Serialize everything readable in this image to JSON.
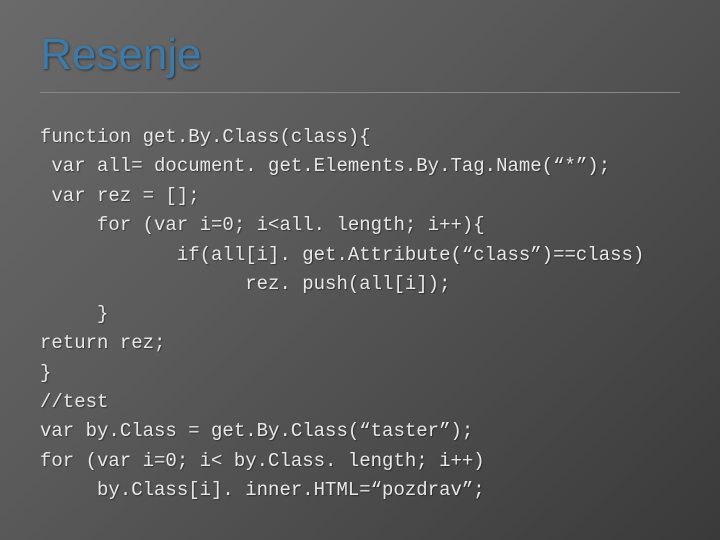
{
  "title": "Resenje",
  "code": {
    "l1": "function get.By.Class(class){",
    "l2": " var all= document. get.Elements.By.Tag.Name(“*”);",
    "l3": " var rez = [];",
    "l4": "     for (var i=0; i<all. length; i++){",
    "l5": "            if(all[i]. get.Attribute(“class”)==class)",
    "l6": "                  rez. push(all[i]);",
    "l7": "     }",
    "l8": "return rez;",
    "l9": "}",
    "l10": "//test",
    "l11": "var by.Class = get.By.Class(“taster”);",
    "l12": "for (var i=0; i< by.Class. length; i++)",
    "l13": "     by.Class[i]. inner.HTML=“pozdrav”;"
  }
}
